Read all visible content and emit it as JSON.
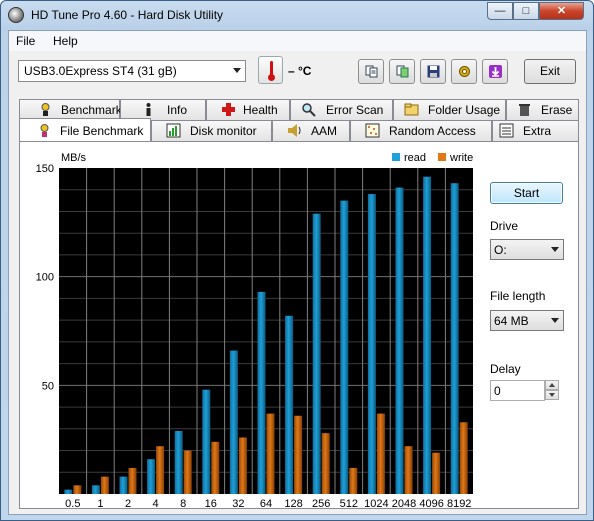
{
  "window": {
    "title": "HD Tune Pro 4.60 - Hard Disk Utility"
  },
  "menu": [
    {
      "label": "File"
    },
    {
      "label": "Help"
    }
  ],
  "toolbar": {
    "drive": "USB3.0Express ST4 (31 gB)",
    "temperature": "– °C",
    "exit_label": "Exit",
    "icons": [
      "copy-text-icon",
      "copy-screenshot-icon",
      "save-icon",
      "options-icon",
      "download-icon"
    ]
  },
  "tabs_top": [
    {
      "label": "Benchmark",
      "icon": "benchmark-icon"
    },
    {
      "label": "Info",
      "icon": "info-icon"
    },
    {
      "label": "Health",
      "icon": "health-icon"
    },
    {
      "label": "Error Scan",
      "icon": "error-scan-icon"
    },
    {
      "label": "Folder Usage",
      "icon": "folder-icon"
    },
    {
      "label": "Erase",
      "icon": "trash-icon"
    }
  ],
  "tabs_bottom": [
    {
      "label": "File Benchmark",
      "icon": "file-benchmark-icon",
      "active": true
    },
    {
      "label": "Disk monitor",
      "icon": "disk-monitor-icon"
    },
    {
      "label": "AAM",
      "icon": "speaker-icon"
    },
    {
      "label": "Random Access",
      "icon": "random-access-icon"
    },
    {
      "label": "Extra tests",
      "icon": "extra-tests-icon"
    }
  ],
  "controls": {
    "start_label": "Start",
    "drive_label": "Drive",
    "drive_value": "O:",
    "file_length_label": "File length",
    "file_length_value": "64 MB",
    "delay_label": "Delay",
    "delay_value": "0"
  },
  "colors": {
    "read": "#1ea0d8",
    "write": "#e07818",
    "chart_bg": "#000000"
  },
  "chart_data": {
    "type": "bar",
    "ylabel": "MB/s",
    "ylim": [
      0,
      150
    ],
    "yticks": [
      50,
      100,
      150
    ],
    "categories": [
      "0.5",
      "1",
      "2",
      "4",
      "8",
      "16",
      "32",
      "64",
      "128",
      "256",
      "512",
      "1024",
      "2048",
      "4096",
      "8192"
    ],
    "series": [
      {
        "name": "read",
        "values": [
          2,
          4,
          8,
          16,
          29,
          48,
          66,
          93,
          82,
          129,
          135,
          138,
          141,
          146,
          143
        ]
      },
      {
        "name": "write",
        "values": [
          4,
          8,
          12,
          22,
          20,
          24,
          26,
          37,
          36,
          28,
          12,
          37,
          22,
          19,
          33
        ]
      }
    ],
    "legend_position": "top-right",
    "grid": true
  }
}
